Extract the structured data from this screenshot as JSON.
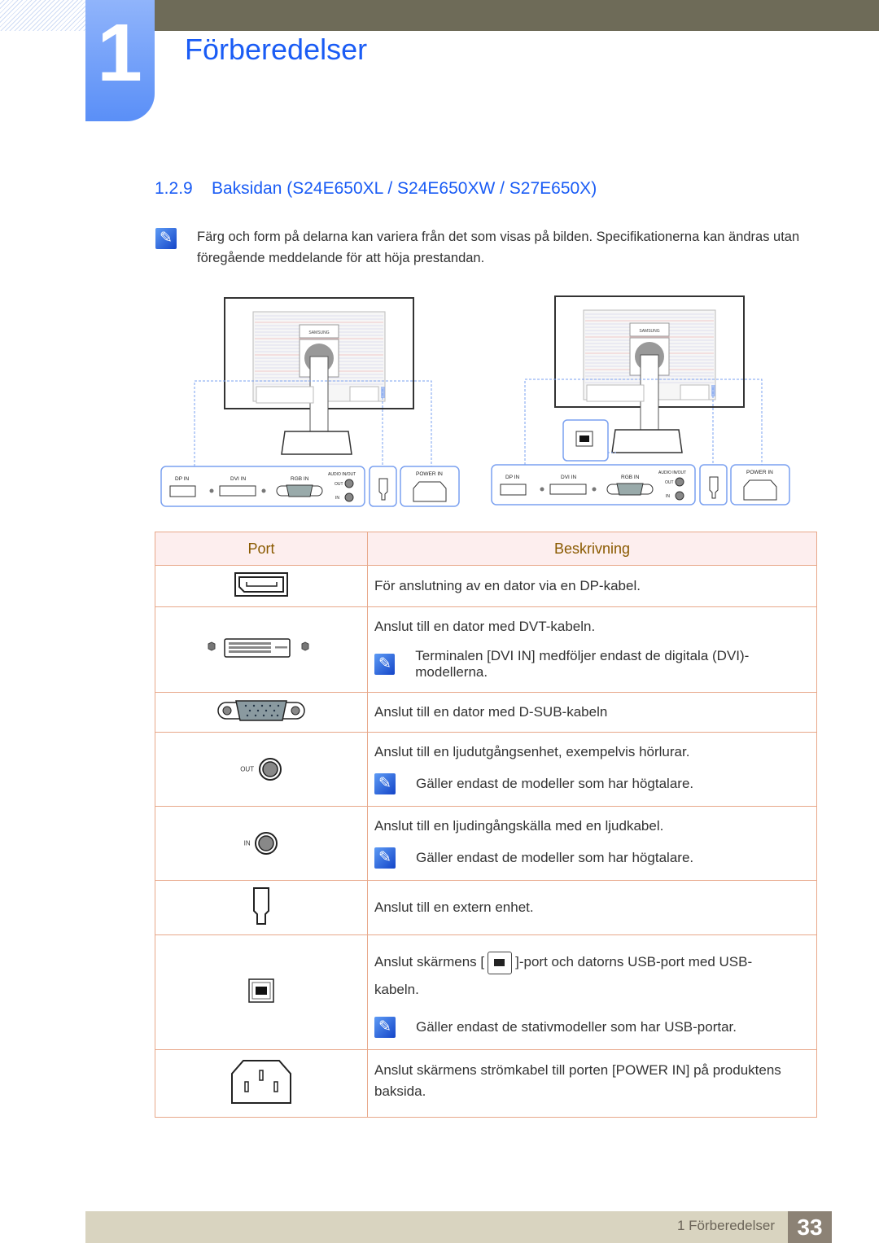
{
  "chapter": {
    "number": "1",
    "title": "Förberedelser"
  },
  "section": {
    "number": "1.2.9",
    "title": "Baksidan (S24E650XL / S24E650XW / S27E650X)"
  },
  "intro_note": "Färg och form på delarna kan variera från det som visas på bilden. Specifikationerna kan ändras utan föregående meddelande för att höja prestandan.",
  "diagram": {
    "brand": "SAMSUNG",
    "dp": "DP IN",
    "dvi": "DVI IN",
    "rgb": "RGB IN",
    "audio": "AUDIO IN/OUT",
    "out": "OUT",
    "in": "IN",
    "power": "POWER IN",
    "accent": "#7aa0f0"
  },
  "table": {
    "headers": [
      "Port",
      "Beskrivning"
    ],
    "rows": [
      {
        "port_icon": "displayport-icon",
        "text": "För anslutning av en dator via en DP-kabel."
      },
      {
        "port_icon": "dvi-port-icon",
        "text": "Anslut till en dator med DVT-kabeln.",
        "note": "Terminalen [DVI IN] medföljer endast de digitala (DVI)-modellerna."
      },
      {
        "port_icon": "vga-port-icon",
        "text": "Anslut till en dator med D-SUB-kabeln"
      },
      {
        "port_icon": "audio-out-icon",
        "port_label": "OUT",
        "text": "Anslut till en ljudutgångsenhet, exempelvis hörlurar.",
        "note": "Gäller endast de modeller som har högtalare."
      },
      {
        "port_icon": "audio-in-icon",
        "port_label": "IN",
        "text": "Anslut till en ljudingångskälla med en ljudkabel.",
        "note": "Gäller endast de modeller som har högtalare."
      },
      {
        "port_icon": "external-port-icon",
        "text": "Anslut till en extern enhet."
      },
      {
        "port_icon": "usb-b-port-icon",
        "text_before": "Anslut skärmens [",
        "text_after": "]-port och datorns USB-port med USB-",
        "text_cont": "kabeln.",
        "note": "Gäller endast de stativmodeller som har USB-portar."
      },
      {
        "port_icon": "power-port-icon",
        "text": "Anslut skärmens strömkabel till porten [POWER IN] på produktens baksida."
      }
    ]
  },
  "footer": {
    "chapter": "1 Förberedelser",
    "page": "33"
  }
}
